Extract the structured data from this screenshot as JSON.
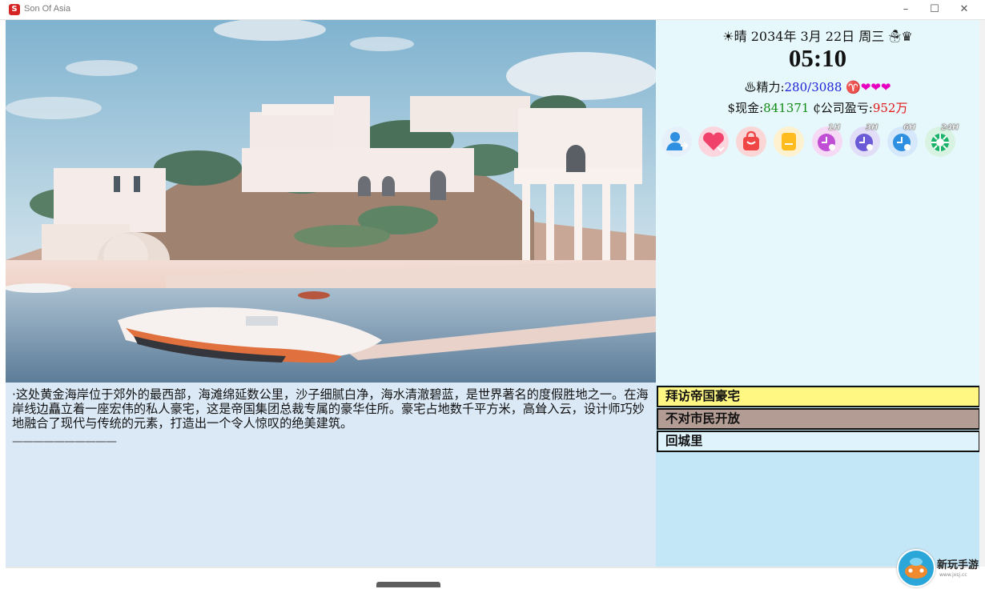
{
  "window": {
    "title": "Son Of Asia",
    "min_glyph": "–",
    "max_glyph": "☐",
    "close_glyph": "✕"
  },
  "status": {
    "weather_icon": "☀",
    "weather": "晴",
    "date": "2034年 3月 22日 周三",
    "date_suffix": "☃♛",
    "time": "05:10",
    "energy_icon": "♨",
    "energy_label": "精力:",
    "energy_value": "280/3088",
    "zodiac": "♈",
    "hearts": "❤❤❤",
    "cash_label": "$现金:",
    "cash_value": "841371",
    "company_label": "₵公司盈亏:",
    "company_value": "952万"
  },
  "toolbar": [
    {
      "name": "contacts-icon",
      "badge": ""
    },
    {
      "name": "heart-icon",
      "badge": ""
    },
    {
      "name": "shopping-bag-icon",
      "badge": ""
    },
    {
      "name": "notes-icon",
      "badge": ""
    },
    {
      "name": "clock-1h-icon",
      "badge": "1H"
    },
    {
      "name": "clock-3h-icon",
      "badge": "3H"
    },
    {
      "name": "clock-6h-icon",
      "badge": "6H"
    },
    {
      "name": "clock-24h-icon",
      "badge": "24H"
    }
  ],
  "description": "·这处黄金海岸位于郊外的最西部，海滩绵延数公里，沙子细腻白净，海水清澈碧蓝，是世界著名的度假胜地之一。在海岸线边矗立着一座宏伟的私人豪宅，这是帝国集团总裁专属的豪华住所。豪宅占地数千平方米，高耸入云，设计师巧妙地融合了现代与传统的元素，打造出一个令人惊叹的绝美建筑。",
  "divider": "——————————",
  "actions": [
    {
      "label": "拜访帝国豪宅"
    },
    {
      "label": "不对市民开放"
    },
    {
      "label": "回城里"
    }
  ],
  "watermark": {
    "text": "新玩手游",
    "sub": "www.jxsj.cc"
  },
  "colors": {
    "right_panel": "#e6f8fb",
    "right_bottom": "#c4e7f8",
    "text_panel": "#dbe9f6",
    "action_visit": "#fff782",
    "action_closed": "#b39c94",
    "action_return": "#dff3fd"
  }
}
